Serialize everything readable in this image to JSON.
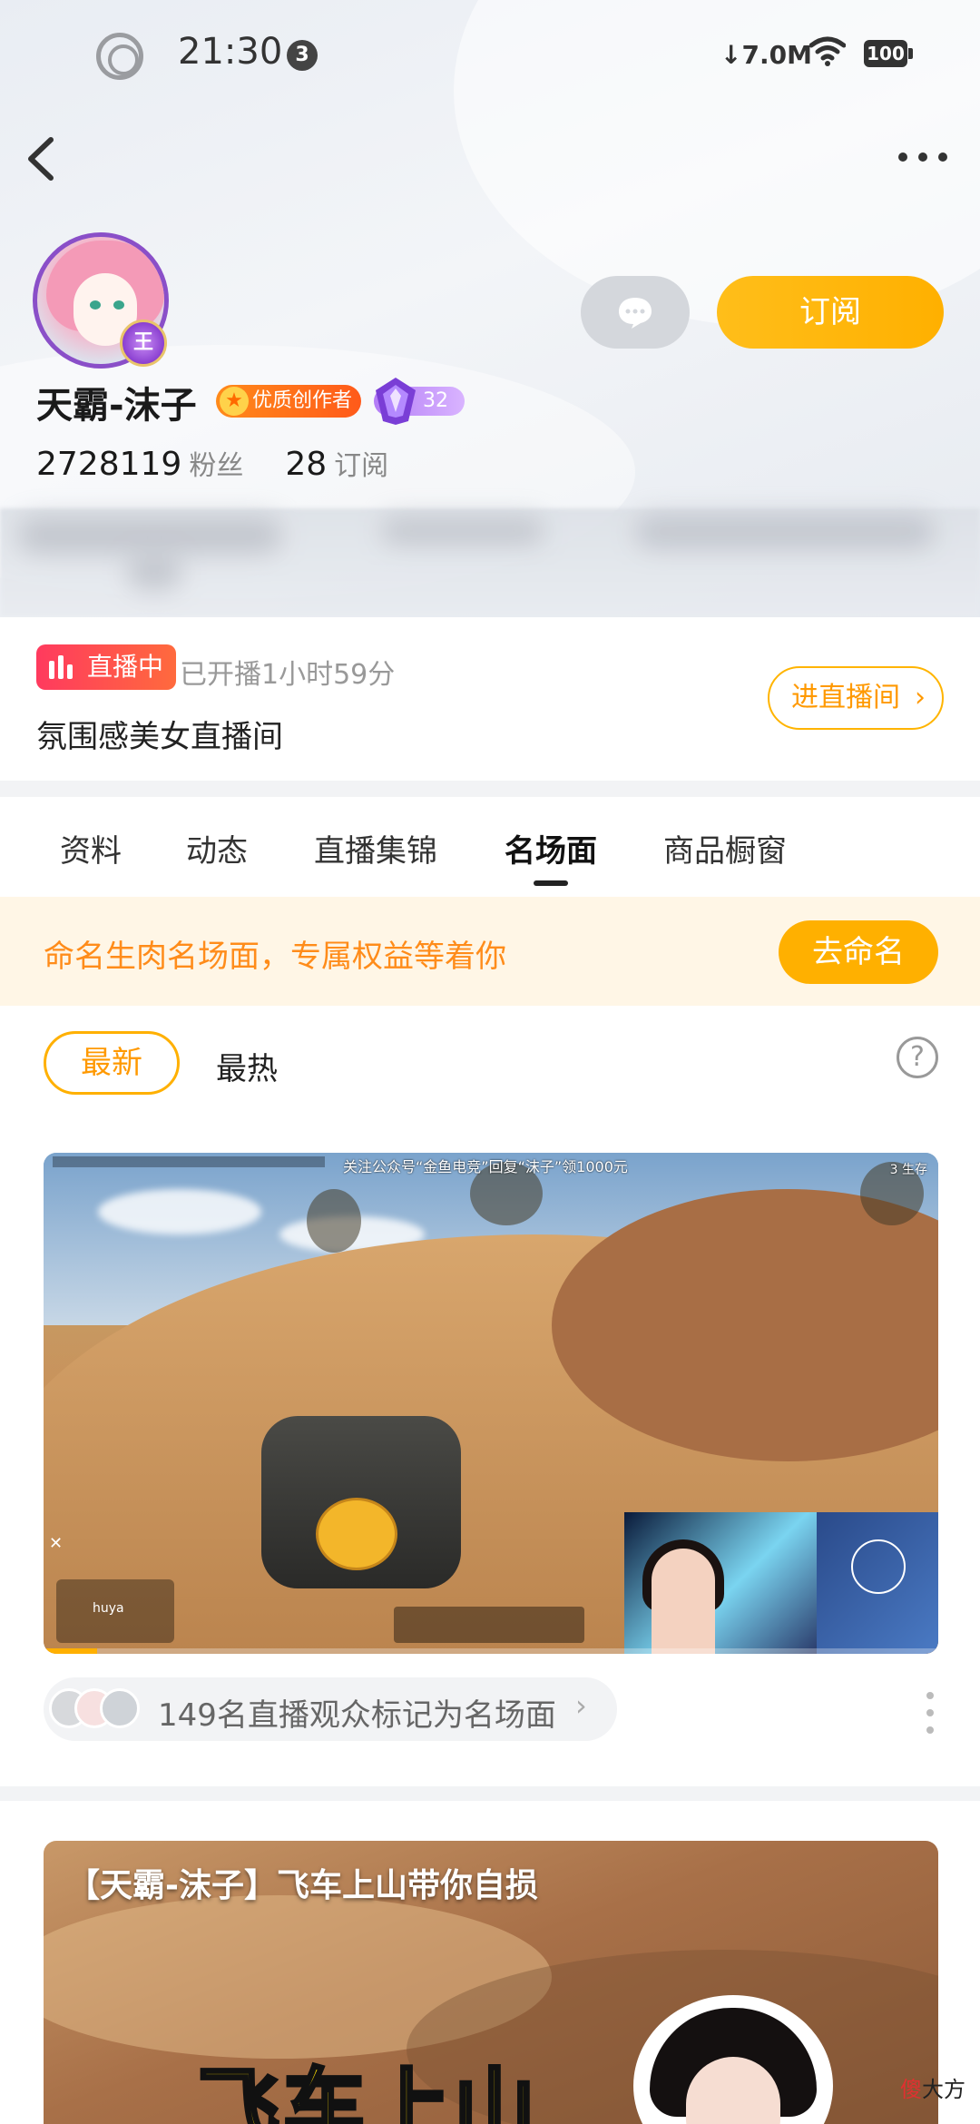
{
  "status_bar": {
    "time": "21:30",
    "notification_count": "3",
    "net_speed": "↓7.0M",
    "battery": "100"
  },
  "profile": {
    "name": "天霸-沫子",
    "creator_badge": "优质创作者",
    "level": "32",
    "fans_count": "2728119",
    "fans_label": "粉丝",
    "subscriptions_count": "28",
    "subscriptions_label": "订阅",
    "subscribe_label": "订阅"
  },
  "live": {
    "badge": "直播中",
    "elapsed": "已开播1小时59分",
    "title": "氛围感美女直播间",
    "enter_label": "进直播间"
  },
  "tabs": [
    {
      "label": "资料"
    },
    {
      "label": "动态"
    },
    {
      "label": "直播集锦"
    },
    {
      "label": "名场面",
      "active": true
    },
    {
      "label": "商品橱窗"
    }
  ],
  "promo": {
    "text": "命名生肉名场面，专属权益等着你",
    "button": "去命名"
  },
  "filters": {
    "newest": "最新",
    "hottest": "最热",
    "help": "?"
  },
  "video1": {
    "overlay_text": "关注公众号“金鱼电竞”回复“沫子”领1000元",
    "survivors": "3 生存",
    "marks_text": "149名直播观众标记为名场面",
    "progress": 0.06
  },
  "video2": {
    "title": "【天霸-沫子】飞车上山带你自损",
    "caption": "飞车上山"
  },
  "watermark": {
    "part1": "傻",
    "part2": "大方"
  },
  "colors": {
    "accent": "#ffb000",
    "live_red": "#ff3a5e",
    "promo_text": "#ff8c1a"
  },
  "icons": [
    "back-icon",
    "more-icon",
    "message-icon",
    "star-icon",
    "gem-icon",
    "chevron-right-icon",
    "help-icon",
    "kebab-icon",
    "wifi-icon",
    "battery-icon"
  ]
}
